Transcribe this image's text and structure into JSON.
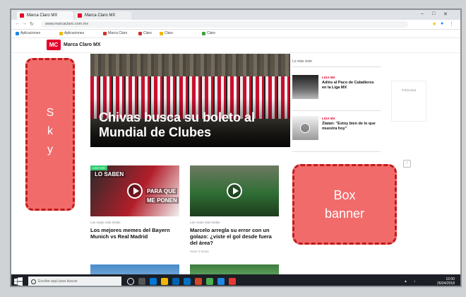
{
  "browser": {
    "tabs": [
      "Marca Claro MX",
      "Marca Claro MX"
    ],
    "url": "www.marcaclaro.com.mx",
    "bookmarks": [
      "Aplicaciones",
      "Aplicaciones",
      "Marca Claro",
      "Claro",
      "Claro",
      "Claro"
    ]
  },
  "site": {
    "logo": "MC",
    "name": "Marca Claro MX"
  },
  "hero": {
    "headline": "Chivas busca su boleto al Mundial de Clubes"
  },
  "cards": [
    {
      "tag": "LIGA MX",
      "overlay_top": "LO SABEN",
      "overlay_mid": "PARA QUE",
      "overlay_bot": "ME PONEN",
      "meta": "Las notas más leídas",
      "headline": "Los mejores memes del Bayern Munich vs Real Madrid"
    },
    {
      "tag": "",
      "meta": "Las notas más leídas",
      "headline": "Marcelo arregla su error con un golazo: ¿viste el gol desde fuera del área?",
      "date": "Hace 2 horas"
    }
  ],
  "sidebar": {
    "label": "Lo más visto",
    "items": [
      {
        "tag": "LIGA MX",
        "text": "Adiós al Paco de Caballeros en la Liga MX"
      },
      {
        "tag": "LIGA MX",
        "text": "Zlatan: \"Estoy bien de lo que muestra hoy\""
      }
    ],
    "ad_placeholder": "Publicidad"
  },
  "taskbar": {
    "search_placeholder": "Escribe aquí para buscar",
    "time": "12:00",
    "date": "26/04/2018"
  },
  "ad_labels": {
    "sky": [
      "S",
      "k",
      "y"
    ],
    "box_line1": "Box",
    "box_line2": "banner"
  }
}
